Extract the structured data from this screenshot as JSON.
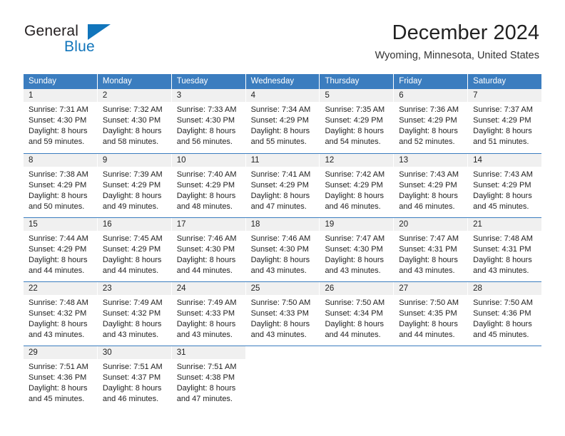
{
  "brand": {
    "word_one": "General",
    "word_two": "Blue",
    "logo_icon": "triangle-icon",
    "color_primary": "#1175bb",
    "color_text": "#231f20"
  },
  "header": {
    "title": "December 2024",
    "subtitle": "Wyoming, Minnesota, United States"
  },
  "calendar": {
    "accent_color": "#3b7dbf",
    "daynum_background": "#f0f0f0",
    "weekday_headers": [
      "Sunday",
      "Monday",
      "Tuesday",
      "Wednesday",
      "Thursday",
      "Friday",
      "Saturday"
    ],
    "weeks": [
      [
        {
          "day": "1",
          "sunrise": "Sunrise: 7:31 AM",
          "sunset": "Sunset: 4:30 PM",
          "daylight_1": "Daylight: 8 hours",
          "daylight_2": "and 59 minutes."
        },
        {
          "day": "2",
          "sunrise": "Sunrise: 7:32 AM",
          "sunset": "Sunset: 4:30 PM",
          "daylight_1": "Daylight: 8 hours",
          "daylight_2": "and 58 minutes."
        },
        {
          "day": "3",
          "sunrise": "Sunrise: 7:33 AM",
          "sunset": "Sunset: 4:30 PM",
          "daylight_1": "Daylight: 8 hours",
          "daylight_2": "and 56 minutes."
        },
        {
          "day": "4",
          "sunrise": "Sunrise: 7:34 AM",
          "sunset": "Sunset: 4:29 PM",
          "daylight_1": "Daylight: 8 hours",
          "daylight_2": "and 55 minutes."
        },
        {
          "day": "5",
          "sunrise": "Sunrise: 7:35 AM",
          "sunset": "Sunset: 4:29 PM",
          "daylight_1": "Daylight: 8 hours",
          "daylight_2": "and 54 minutes."
        },
        {
          "day": "6",
          "sunrise": "Sunrise: 7:36 AM",
          "sunset": "Sunset: 4:29 PM",
          "daylight_1": "Daylight: 8 hours",
          "daylight_2": "and 52 minutes."
        },
        {
          "day": "7",
          "sunrise": "Sunrise: 7:37 AM",
          "sunset": "Sunset: 4:29 PM",
          "daylight_1": "Daylight: 8 hours",
          "daylight_2": "and 51 minutes."
        }
      ],
      [
        {
          "day": "8",
          "sunrise": "Sunrise: 7:38 AM",
          "sunset": "Sunset: 4:29 PM",
          "daylight_1": "Daylight: 8 hours",
          "daylight_2": "and 50 minutes."
        },
        {
          "day": "9",
          "sunrise": "Sunrise: 7:39 AM",
          "sunset": "Sunset: 4:29 PM",
          "daylight_1": "Daylight: 8 hours",
          "daylight_2": "and 49 minutes."
        },
        {
          "day": "10",
          "sunrise": "Sunrise: 7:40 AM",
          "sunset": "Sunset: 4:29 PM",
          "daylight_1": "Daylight: 8 hours",
          "daylight_2": "and 48 minutes."
        },
        {
          "day": "11",
          "sunrise": "Sunrise: 7:41 AM",
          "sunset": "Sunset: 4:29 PM",
          "daylight_1": "Daylight: 8 hours",
          "daylight_2": "and 47 minutes."
        },
        {
          "day": "12",
          "sunrise": "Sunrise: 7:42 AM",
          "sunset": "Sunset: 4:29 PM",
          "daylight_1": "Daylight: 8 hours",
          "daylight_2": "and 46 minutes."
        },
        {
          "day": "13",
          "sunrise": "Sunrise: 7:43 AM",
          "sunset": "Sunset: 4:29 PM",
          "daylight_1": "Daylight: 8 hours",
          "daylight_2": "and 46 minutes."
        },
        {
          "day": "14",
          "sunrise": "Sunrise: 7:43 AM",
          "sunset": "Sunset: 4:29 PM",
          "daylight_1": "Daylight: 8 hours",
          "daylight_2": "and 45 minutes."
        }
      ],
      [
        {
          "day": "15",
          "sunrise": "Sunrise: 7:44 AM",
          "sunset": "Sunset: 4:29 PM",
          "daylight_1": "Daylight: 8 hours",
          "daylight_2": "and 44 minutes."
        },
        {
          "day": "16",
          "sunrise": "Sunrise: 7:45 AM",
          "sunset": "Sunset: 4:29 PM",
          "daylight_1": "Daylight: 8 hours",
          "daylight_2": "and 44 minutes."
        },
        {
          "day": "17",
          "sunrise": "Sunrise: 7:46 AM",
          "sunset": "Sunset: 4:30 PM",
          "daylight_1": "Daylight: 8 hours",
          "daylight_2": "and 44 minutes."
        },
        {
          "day": "18",
          "sunrise": "Sunrise: 7:46 AM",
          "sunset": "Sunset: 4:30 PM",
          "daylight_1": "Daylight: 8 hours",
          "daylight_2": "and 43 minutes."
        },
        {
          "day": "19",
          "sunrise": "Sunrise: 7:47 AM",
          "sunset": "Sunset: 4:30 PM",
          "daylight_1": "Daylight: 8 hours",
          "daylight_2": "and 43 minutes."
        },
        {
          "day": "20",
          "sunrise": "Sunrise: 7:47 AM",
          "sunset": "Sunset: 4:31 PM",
          "daylight_1": "Daylight: 8 hours",
          "daylight_2": "and 43 minutes."
        },
        {
          "day": "21",
          "sunrise": "Sunrise: 7:48 AM",
          "sunset": "Sunset: 4:31 PM",
          "daylight_1": "Daylight: 8 hours",
          "daylight_2": "and 43 minutes."
        }
      ],
      [
        {
          "day": "22",
          "sunrise": "Sunrise: 7:48 AM",
          "sunset": "Sunset: 4:32 PM",
          "daylight_1": "Daylight: 8 hours",
          "daylight_2": "and 43 minutes."
        },
        {
          "day": "23",
          "sunrise": "Sunrise: 7:49 AM",
          "sunset": "Sunset: 4:32 PM",
          "daylight_1": "Daylight: 8 hours",
          "daylight_2": "and 43 minutes."
        },
        {
          "day": "24",
          "sunrise": "Sunrise: 7:49 AM",
          "sunset": "Sunset: 4:33 PM",
          "daylight_1": "Daylight: 8 hours",
          "daylight_2": "and 43 minutes."
        },
        {
          "day": "25",
          "sunrise": "Sunrise: 7:50 AM",
          "sunset": "Sunset: 4:33 PM",
          "daylight_1": "Daylight: 8 hours",
          "daylight_2": "and 43 minutes."
        },
        {
          "day": "26",
          "sunrise": "Sunrise: 7:50 AM",
          "sunset": "Sunset: 4:34 PM",
          "daylight_1": "Daylight: 8 hours",
          "daylight_2": "and 44 minutes."
        },
        {
          "day": "27",
          "sunrise": "Sunrise: 7:50 AM",
          "sunset": "Sunset: 4:35 PM",
          "daylight_1": "Daylight: 8 hours",
          "daylight_2": "and 44 minutes."
        },
        {
          "day": "28",
          "sunrise": "Sunrise: 7:50 AM",
          "sunset": "Sunset: 4:36 PM",
          "daylight_1": "Daylight: 8 hours",
          "daylight_2": "and 45 minutes."
        }
      ],
      [
        {
          "day": "29",
          "sunrise": "Sunrise: 7:51 AM",
          "sunset": "Sunset: 4:36 PM",
          "daylight_1": "Daylight: 8 hours",
          "daylight_2": "and 45 minutes."
        },
        {
          "day": "30",
          "sunrise": "Sunrise: 7:51 AM",
          "sunset": "Sunset: 4:37 PM",
          "daylight_1": "Daylight: 8 hours",
          "daylight_2": "and 46 minutes."
        },
        {
          "day": "31",
          "sunrise": "Sunrise: 7:51 AM",
          "sunset": "Sunset: 4:38 PM",
          "daylight_1": "Daylight: 8 hours",
          "daylight_2": "and 47 minutes."
        },
        {
          "day": "",
          "sunrise": "",
          "sunset": "",
          "daylight_1": "",
          "daylight_2": ""
        },
        {
          "day": "",
          "sunrise": "",
          "sunset": "",
          "daylight_1": "",
          "daylight_2": ""
        },
        {
          "day": "",
          "sunrise": "",
          "sunset": "",
          "daylight_1": "",
          "daylight_2": ""
        },
        {
          "day": "",
          "sunrise": "",
          "sunset": "",
          "daylight_1": "",
          "daylight_2": ""
        }
      ]
    ]
  }
}
